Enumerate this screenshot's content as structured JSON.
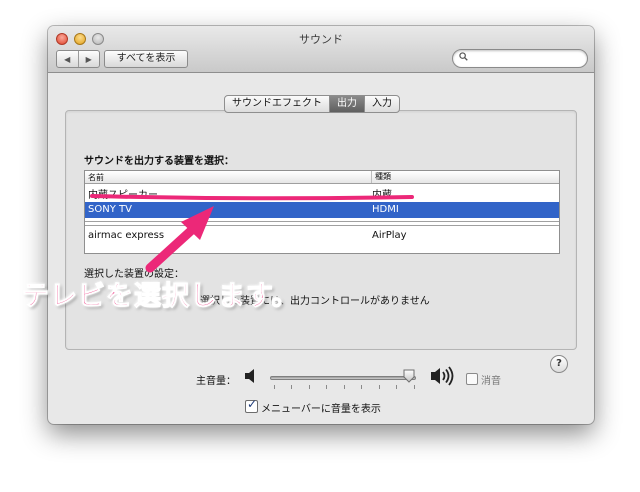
{
  "window": {
    "title": "サウンド",
    "show_all_label": "すべてを表示",
    "nav_back": "◀",
    "nav_forward": "▶",
    "search": {
      "placeholder": ""
    }
  },
  "tabs": [
    {
      "label": "サウンドエフェクト",
      "active": false
    },
    {
      "label": "出力",
      "active": true
    },
    {
      "label": "入力",
      "active": false
    }
  ],
  "output": {
    "select_label": "サウンドを出力する装置を選択：",
    "columns": {
      "name": "名前",
      "type": "種類"
    },
    "devices": [
      {
        "name": "内蔵スピーカー",
        "type": "内蔵",
        "selected": false
      },
      {
        "name": "SONY TV",
        "type": "HDMI",
        "selected": true
      },
      {
        "name": "airmac express",
        "type": "AirPlay",
        "selected": false
      }
    ],
    "settings_label": "選択した装置の設定：",
    "no_controls_text": "選択した装置には、出力コントロールがありません",
    "help_label": "?"
  },
  "volume": {
    "label": "主音量：",
    "level": 0.95,
    "mute_label": "消音",
    "mute_checked": false,
    "menu_bar_label": "メニューバーに音量を表示",
    "menu_bar_checked": true
  },
  "annotation": {
    "callout_text": "テレビを選択します。",
    "color": "#ec2878"
  },
  "colors": {
    "selection": "#3264c8",
    "annotation": "#ec2878"
  }
}
